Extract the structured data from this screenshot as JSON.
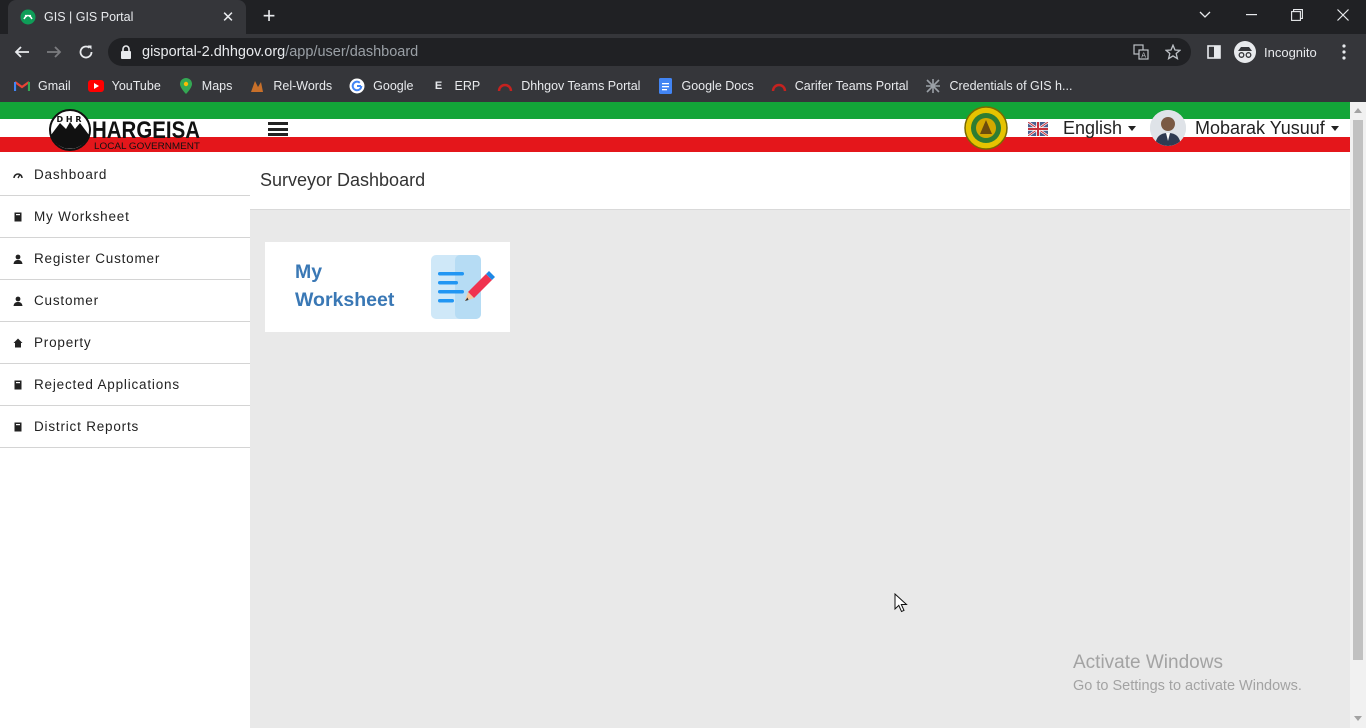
{
  "browser": {
    "tab": {
      "title": "GIS | GIS Portal"
    },
    "address": {
      "host": "gisportal-2.dhhgov.org",
      "path": "/app/user/dashboard"
    },
    "profile_label": "Incognito",
    "bookmarks": [
      {
        "label": "Gmail",
        "icon": "gmail-icon"
      },
      {
        "label": "YouTube",
        "icon": "youtube-icon"
      },
      {
        "label": "Maps",
        "icon": "maps-icon"
      },
      {
        "label": "Rel-Words",
        "icon": "rel-words-icon"
      },
      {
        "label": "Google",
        "icon": "google-icon"
      },
      {
        "label": "ERP",
        "icon": "erp-icon"
      },
      {
        "label": "Dhhgov Teams Portal",
        "icon": "teams-portal-icon"
      },
      {
        "label": "Google Docs",
        "icon": "google-docs-icon"
      },
      {
        "label": "Carifer Teams Portal",
        "icon": "teams-portal-icon"
      },
      {
        "label": "Credentials of GIS h...",
        "icon": "credentials-icon"
      }
    ]
  },
  "header": {
    "logo_text": "HARGEISA",
    "logo_subtext": "LOCAL GOVERNMENT",
    "logo_badge": "D H R",
    "language": "English",
    "user_name": "Mobarak Yusuuf"
  },
  "sidebar": {
    "items": [
      {
        "label": "Dashboard",
        "icon": "dashboard-icon"
      },
      {
        "label": "My Worksheet",
        "icon": "book-icon"
      },
      {
        "label": "Register Customer",
        "icon": "user-icon"
      },
      {
        "label": "Customer",
        "icon": "user-icon"
      },
      {
        "label": "Property",
        "icon": "home-icon"
      },
      {
        "label": "Rejected Applications",
        "icon": "book-icon"
      },
      {
        "label": "District Reports",
        "icon": "book-icon"
      }
    ]
  },
  "main": {
    "title": "Surveyor Dashboard",
    "card": {
      "label": "My Worksheet",
      "icon": "worksheet-edit-icon"
    }
  },
  "watermark": {
    "title": "Activate Windows",
    "subtitle": "Go to Settings to activate Windows."
  },
  "colors": {
    "flag_green": "#13a538",
    "flag_red": "#e4161b",
    "card_label": "#3a78b5",
    "page_bg": "#e9e9e9"
  }
}
